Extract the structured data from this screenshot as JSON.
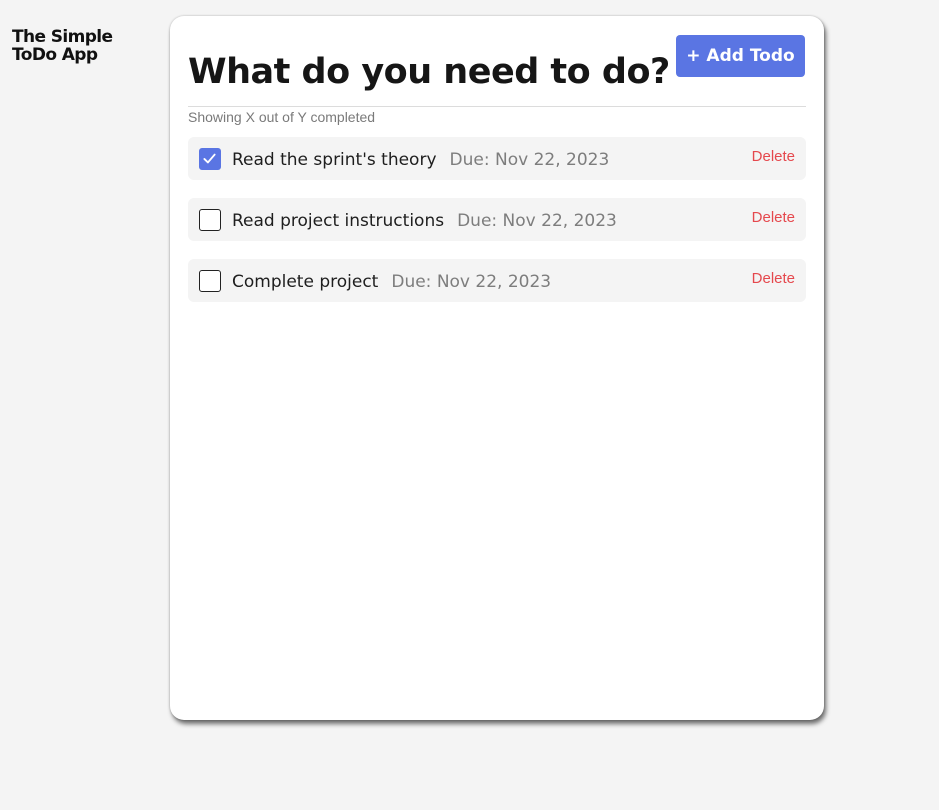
{
  "app": {
    "title": "The Simple ToDo App"
  },
  "header": {
    "heading": "What do you need to do?",
    "add_button_label": "+ Add Todo"
  },
  "summary": {
    "text": "Showing X out of Y completed"
  },
  "todos": [
    {
      "label": "Read the sprint's theory",
      "due": "Due: Nov 22, 2023",
      "completed": true,
      "delete_label": "Delete"
    },
    {
      "label": "Read project instructions",
      "due": "Due: Nov 22, 2023",
      "completed": false,
      "delete_label": "Delete"
    },
    {
      "label": "Complete project",
      "due": "Due: Nov 22, 2023",
      "completed": false,
      "delete_label": "Delete"
    }
  ],
  "colors": {
    "accent": "#5a75e3",
    "danger": "#e5484d",
    "background": "#f4f4f4",
    "item_background": "#f4f4f4"
  },
  "icons": {
    "checkbox_checked": "check-icon"
  }
}
